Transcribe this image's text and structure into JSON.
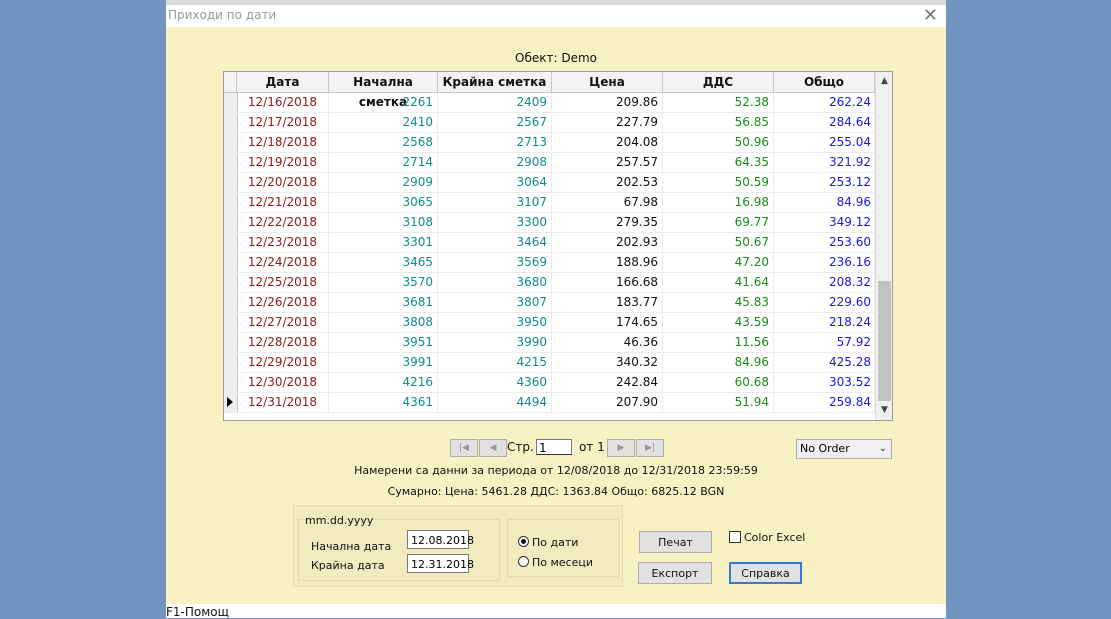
{
  "window": {
    "title": "Приходи по дати",
    "close_glyph": "✕"
  },
  "object_label": "Обект: Demo",
  "table": {
    "columns": [
      "Дата",
      "Начална сметка",
      "Крайна сметка",
      "Цена",
      "ДДС",
      "Общо"
    ],
    "rows": [
      [
        "12/16/2018",
        "2261",
        "2409",
        "209.86",
        "52.38",
        "262.24"
      ],
      [
        "12/17/2018",
        "2410",
        "2567",
        "227.79",
        "56.85",
        "284.64"
      ],
      [
        "12/18/2018",
        "2568",
        "2713",
        "204.08",
        "50.96",
        "255.04"
      ],
      [
        "12/19/2018",
        "2714",
        "2908",
        "257.57",
        "64.35",
        "321.92"
      ],
      [
        "12/20/2018",
        "2909",
        "3064",
        "202.53",
        "50.59",
        "253.12"
      ],
      [
        "12/21/2018",
        "3065",
        "3107",
        "67.98",
        "16.98",
        "84.96"
      ],
      [
        "12/22/2018",
        "3108",
        "3300",
        "279.35",
        "69.77",
        "349.12"
      ],
      [
        "12/23/2018",
        "3301",
        "3464",
        "202.93",
        "50.67",
        "253.60"
      ],
      [
        "12/24/2018",
        "3465",
        "3569",
        "188.96",
        "47.20",
        "236.16"
      ],
      [
        "12/25/2018",
        "3570",
        "3680",
        "166.68",
        "41.64",
        "208.32"
      ],
      [
        "12/26/2018",
        "3681",
        "3807",
        "183.77",
        "45.83",
        "229.60"
      ],
      [
        "12/27/2018",
        "3808",
        "3950",
        "174.65",
        "43.59",
        "218.24"
      ],
      [
        "12/28/2018",
        "3951",
        "3990",
        "46.36",
        "11.56",
        "57.92"
      ],
      [
        "12/29/2018",
        "3991",
        "4215",
        "340.32",
        "84.96",
        "425.28"
      ],
      [
        "12/30/2018",
        "4216",
        "4360",
        "242.84",
        "60.68",
        "303.52"
      ],
      [
        "12/31/2018",
        "4361",
        "4494",
        "207.90",
        "51.94",
        "259.84"
      ]
    ],
    "current_row_index": 15
  },
  "pager": {
    "label": "Стр.",
    "page": "1",
    "of_label": "от 1"
  },
  "order": {
    "selected": "No Order"
  },
  "info": {
    "found": "Намерени са данни за периода от 12/08/2018  до 12/31/2018 23:59:59",
    "summary": "Сумарно:  Цена: 5461.28   ДДС: 1363.84  Общо: 6825.12 BGN"
  },
  "dates": {
    "format": "mm.dd.yyyy",
    "start_label": "Начална дата",
    "start_value": "12.08.2018",
    "end_label": "Крайна дата",
    "end_value": "12.31.2018"
  },
  "grouping": {
    "by_dates": "По дати",
    "by_months": "По месеци",
    "selected": "by_dates"
  },
  "buttons": {
    "print": "Печат",
    "export": "Експорт",
    "help": "Справка"
  },
  "color_excel": {
    "label": "Color Excel",
    "checked": false
  },
  "status_bar": "F1-Помощ",
  "colors": {
    "dialog_bg": "#f7f1c3",
    "date_text": "#8b1a1a",
    "account_text": "#138a8a",
    "vat_text": "#1a8a1a",
    "total_text": "#1a1adb",
    "desktop": "#7194c0"
  }
}
